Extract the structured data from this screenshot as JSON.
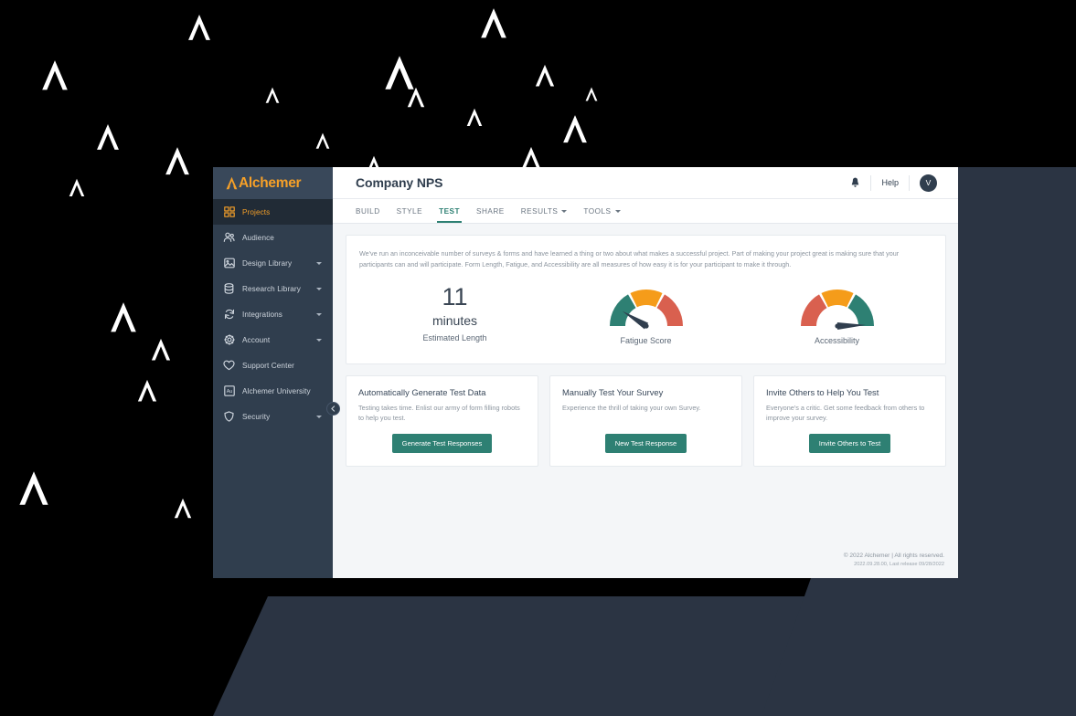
{
  "brand": {
    "name": "Alchemer",
    "accent_orange": "#f6a028",
    "accent_teal": "#2e8073",
    "sidebar_bg": "#303e4e",
    "gauge_red": "#d9604f",
    "gauge_orange": "#f59c1a",
    "gauge_teal": "#2e8073"
  },
  "sidebar": {
    "items": [
      {
        "label": "Projects",
        "icon": "grid-icon",
        "active": true,
        "caret": false
      },
      {
        "label": "Audience",
        "icon": "people-icon",
        "active": false,
        "caret": false
      },
      {
        "label": "Design Library",
        "icon": "image-icon",
        "active": false,
        "caret": true
      },
      {
        "label": "Research Library",
        "icon": "database-icon",
        "active": false,
        "caret": true
      },
      {
        "label": "Integrations",
        "icon": "refresh-icon",
        "active": false,
        "caret": true
      },
      {
        "label": "Account",
        "icon": "gear-icon",
        "active": false,
        "caret": true
      },
      {
        "label": "Support Center",
        "icon": "heart-icon",
        "active": false,
        "caret": false
      },
      {
        "label": "Alchemer University",
        "icon": "au-badge-icon",
        "active": false,
        "caret": false
      },
      {
        "label": "Security",
        "icon": "shield-icon",
        "active": false,
        "caret": true
      }
    ]
  },
  "header": {
    "title": "Company NPS",
    "help_label": "Help",
    "avatar_initial": "V",
    "bell_icon": "bell-icon"
  },
  "tabs": [
    {
      "label": "BUILD",
      "active": false,
      "caret": false
    },
    {
      "label": "STYLE",
      "active": false,
      "caret": false
    },
    {
      "label": "TEST",
      "active": true,
      "caret": false
    },
    {
      "label": "SHARE",
      "active": false,
      "caret": false
    },
    {
      "label": "RESULTS",
      "active": false,
      "caret": true
    },
    {
      "label": "TOOLS",
      "active": false,
      "caret": true
    }
  ],
  "main": {
    "intro": "We've run an inconceivable number of surveys & forms and have learned a thing or two about what makes a successful project. Part of making your project great is making sure that your participants can and will participate. Form Length, Fatigue, and Accessibility are all measures of how easy it is for your participant to make it through.",
    "length_metric": {
      "value": "11",
      "unit": "minutes",
      "caption": "Estimated Length"
    }
  },
  "chart_data": [
    {
      "type": "gauge",
      "title": "Fatigue Score",
      "segments": [
        {
          "label": "low",
          "color": "#2e8073",
          "start_deg": 0,
          "end_deg": 60
        },
        {
          "label": "medium",
          "color": "#f59c1a",
          "start_deg": 64,
          "end_deg": 116
        },
        {
          "label": "high",
          "color": "#d9604f",
          "start_deg": 120,
          "end_deg": 180
        }
      ],
      "needle_deg": 32,
      "value_zone": "low"
    },
    {
      "type": "gauge",
      "title": "Accessibility",
      "segments": [
        {
          "label": "poor",
          "color": "#d9604f",
          "start_deg": 0,
          "end_deg": 60
        },
        {
          "label": "fair",
          "color": "#f59c1a",
          "start_deg": 64,
          "end_deg": 116
        },
        {
          "label": "excellent",
          "color": "#2e8073",
          "start_deg": 120,
          "end_deg": 180
        }
      ],
      "needle_deg": 178,
      "value_zone": "excellent"
    }
  ],
  "cards": [
    {
      "title": "Automatically Generate Test Data",
      "text": "Testing takes time. Enlist our army of form filling robots to help you test.",
      "button": "Generate Test Responses"
    },
    {
      "title": "Manually Test Your Survey",
      "text": "Experience the thrill of taking your own Survey.",
      "button": "New Test Response"
    },
    {
      "title": "Invite Others to Help You Test",
      "text": "Everyone's a critic. Get some feedback from others to improve your survey.",
      "button": "Invite Others to Test"
    }
  ],
  "footer": {
    "copyright": "© 2022 Alchemer | All rights reserved.",
    "version": "2022.09.28.00, Last release 09/28/2022"
  }
}
